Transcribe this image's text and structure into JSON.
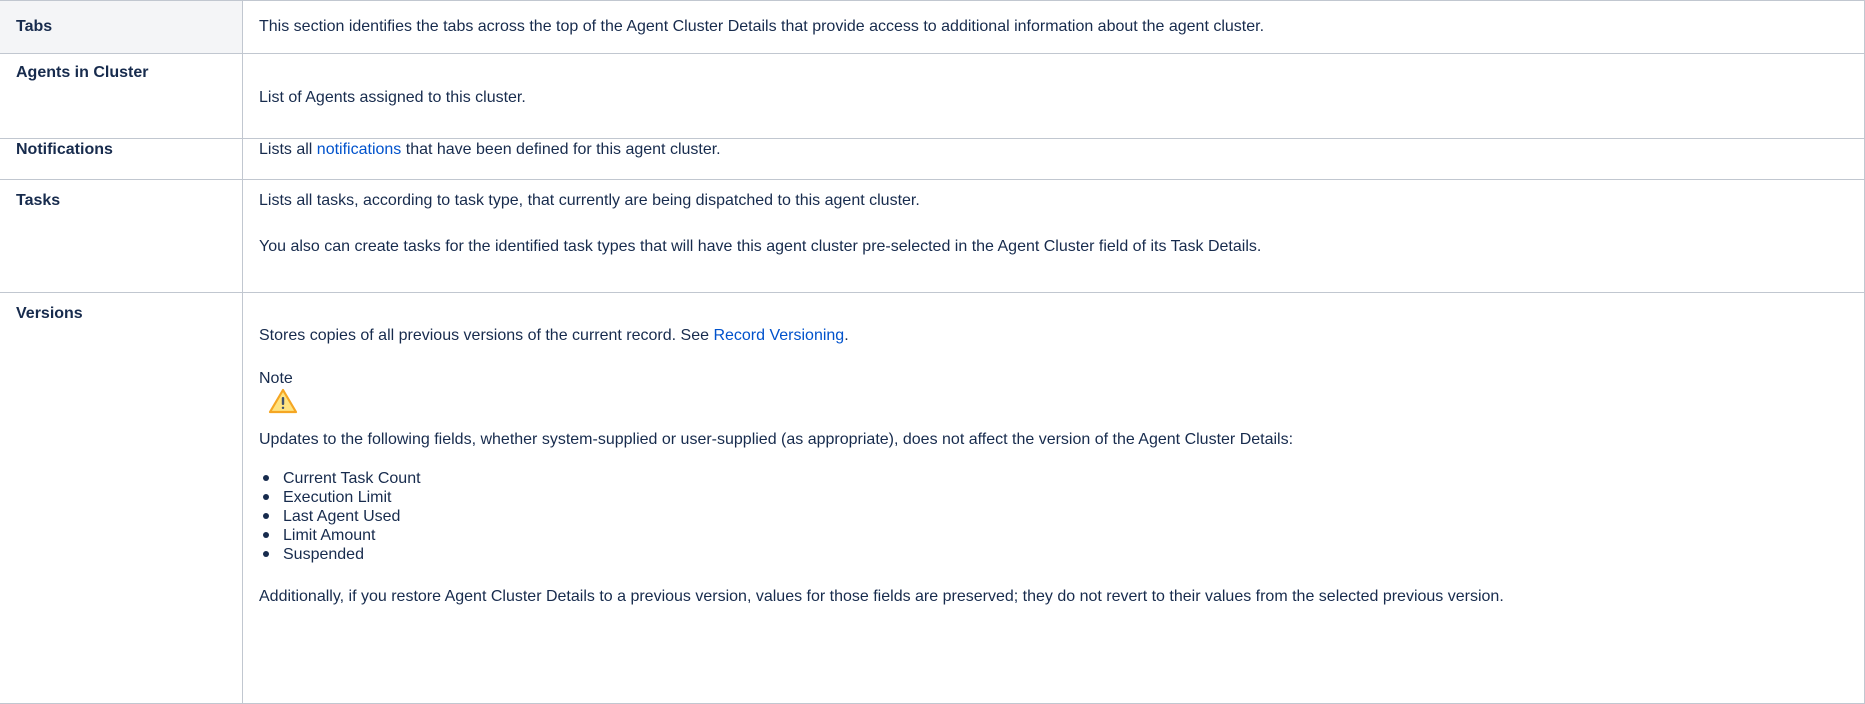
{
  "table": {
    "header": {
      "label": "Tabs",
      "description": "This section identifies the tabs across the top of the Agent Cluster Details that provide access to additional information about the agent cluster."
    },
    "agents": {
      "label": "Agents in Cluster",
      "description": "List of Agents assigned to this cluster."
    },
    "notifications": {
      "label": "Notifications",
      "text_before": "Lists all ",
      "link_text": "notifications",
      "text_after": " that have been defined for this agent cluster."
    },
    "tasks": {
      "label": "Tasks",
      "paragraph1": "Lists all tasks, according to task type, that currently are being dispatched to this agent cluster.",
      "paragraph2": "You also can create tasks for the identified task types that will have this agent cluster pre-selected in the Agent Cluster field of its Task Details."
    },
    "versions": {
      "label": "Versions",
      "intro_before": "Stores copies of all previous versions of the current record. See ",
      "intro_link": "Record Versioning",
      "intro_after": ".",
      "note_title": "Note",
      "note_icon": "warning-icon",
      "updates_text": "Updates to the following fields, whether system-supplied or user-supplied (as appropriate), does not affect the version of the Agent Cluster Details:",
      "fields": [
        "Current Task Count",
        "Execution Limit",
        "Last Agent Used",
        "Limit Amount",
        "Suspended"
      ],
      "additionally": "Additionally, if you restore Agent Cluster Details to a previous version, values for those fields are preserved; they do not revert to their values from the selected previous version."
    }
  },
  "colors": {
    "link": "#0052cc",
    "text": "#172b4d",
    "border": "#c1c7d0",
    "header_bg": "#f4f5f7",
    "warning": "#f5c518"
  }
}
